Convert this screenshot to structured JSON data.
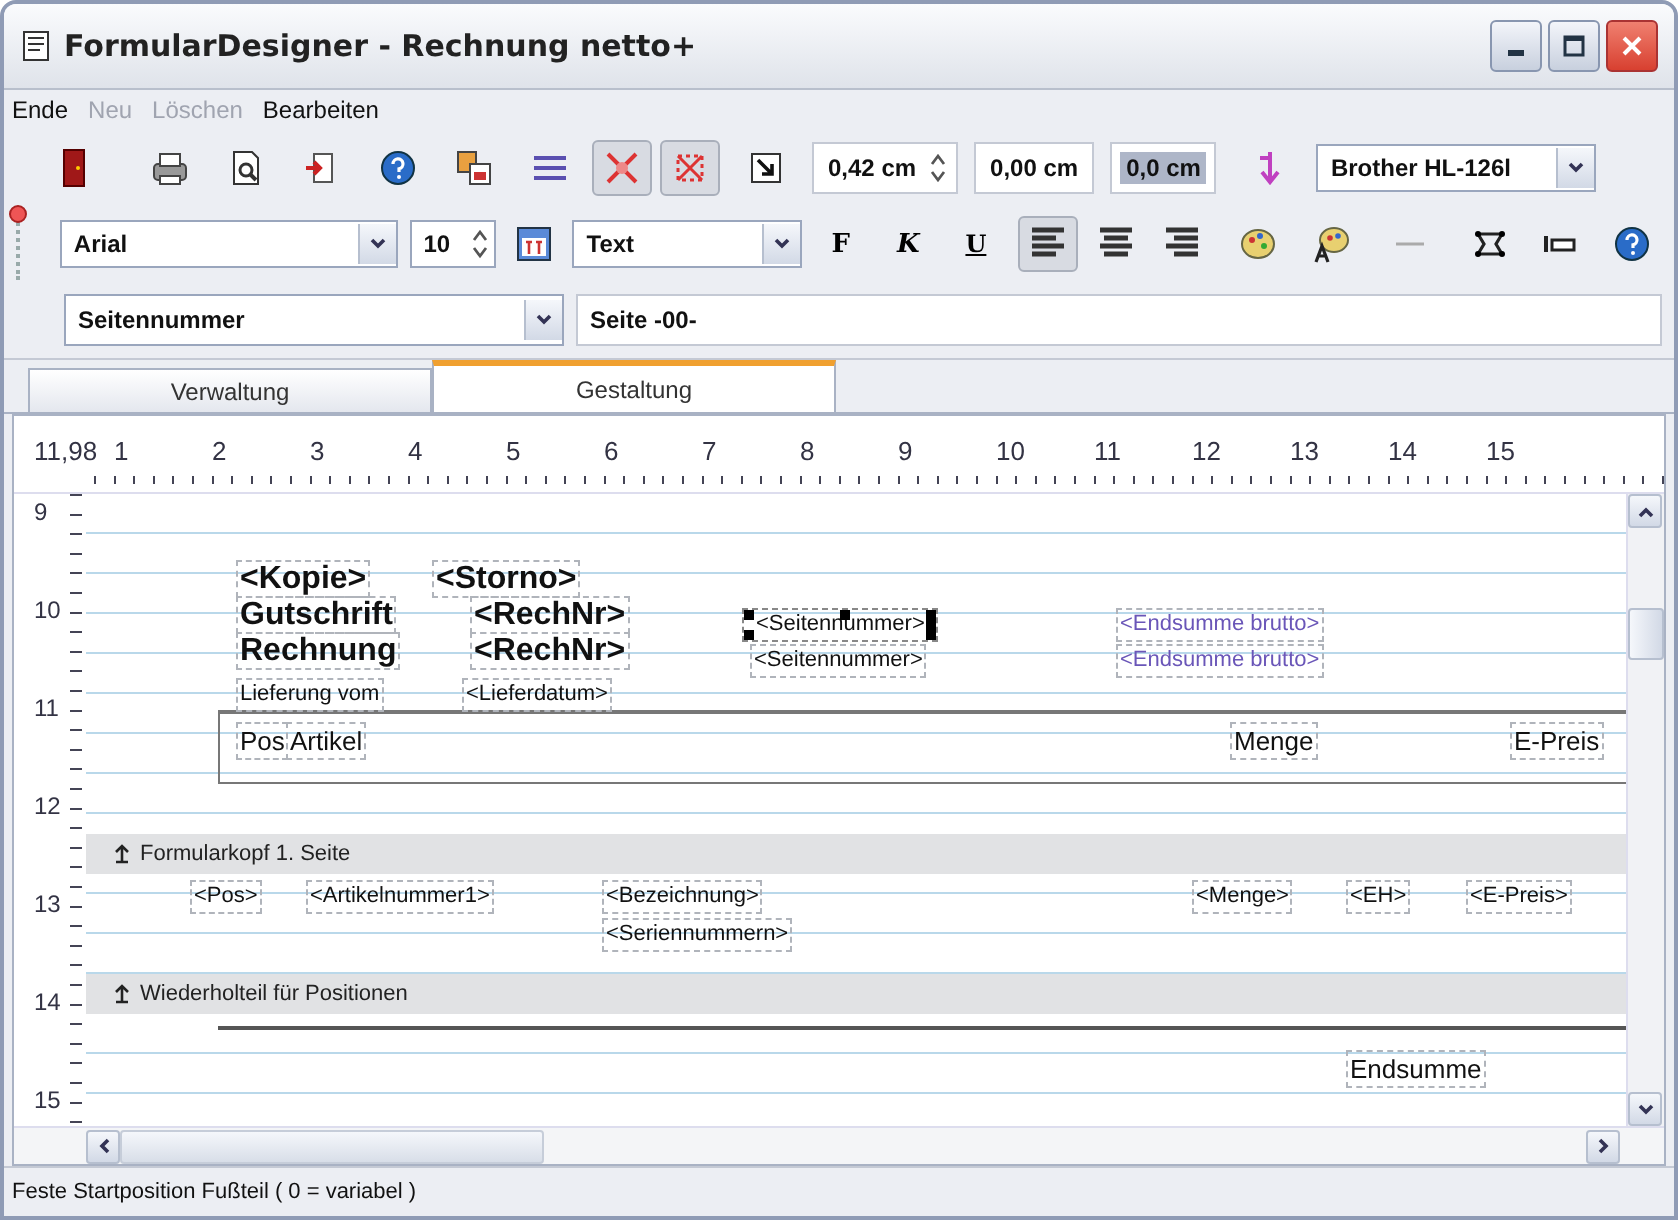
{
  "window": {
    "title": "FormularDesigner - Rechnung netto+"
  },
  "menu": [
    {
      "label": "Ende",
      "disabled": false
    },
    {
      "label": "Neu",
      "disabled": true
    },
    {
      "label": "Löschen",
      "disabled": true
    },
    {
      "label": "Bearbeiten",
      "disabled": false
    }
  ],
  "toolbar": {
    "buttons": [
      {
        "pressed": false
      },
      {
        "pressed": false
      },
      {
        "pressed": false
      },
      {
        "pressed": false
      },
      {
        "pressed": false
      },
      {
        "pressed": false
      },
      {
        "pressed": false
      },
      {
        "pressed": true
      },
      {
        "pressed": true
      },
      {
        "pressed": false
      }
    ],
    "measure_fields": [
      {
        "value": "0,42 cm",
        "kind": "spin",
        "selected": false
      },
      {
        "value": "0,00 cm",
        "kind": "plain",
        "selected": false
      },
      {
        "value": "0,0 cm",
        "kind": "plain",
        "selected": true
      }
    ],
    "printer": {
      "value": "Brother HL-126l"
    }
  },
  "format_bar": {
    "font": "Arial",
    "size": "10",
    "style": "Text",
    "text_buttons": [
      {
        "label": "F",
        "pressed": false
      },
      {
        "label": "K",
        "pressed": false
      },
      {
        "label": "U",
        "pressed": false
      }
    ],
    "buttons": [
      {
        "pressed": true
      },
      {
        "pressed": false
      },
      {
        "pressed": false
      },
      {
        "pressed": false
      },
      {
        "pressed": false
      },
      {
        "pressed": false
      },
      {
        "pressed": false
      },
      {
        "pressed": false
      },
      {
        "pressed": false
      }
    ]
  },
  "field_row": {
    "field": "Seitennummer",
    "content": "Seite -00-"
  },
  "tabs": [
    {
      "label": "Verwaltung",
      "selected": false
    },
    {
      "label": "Gestaltung",
      "selected": true
    }
  ],
  "ruler": {
    "horizontal": [
      "11,98",
      "1",
      "2",
      "3",
      "4",
      "5",
      "6",
      "7",
      "8",
      "9",
      "10",
      "11",
      "12",
      "13",
      "14",
      "15"
    ],
    "vertical": [
      "9",
      "10",
      "11",
      "12",
      "13",
      "14",
      "15"
    ]
  },
  "bands": [
    {
      "label": "Formularkopf 1. Seite"
    },
    {
      "label": "Wiederholteil für Positionen"
    }
  ],
  "fields": [
    {
      "text": "<Kopie>",
      "kind": "heading",
      "color": "#111111",
      "selected": false
    },
    {
      "text": "<Storno>",
      "kind": "heading",
      "color": "#111111",
      "selected": false
    },
    {
      "text": "Gutschrift",
      "kind": "heading",
      "color": "#111111",
      "selected": false
    },
    {
      "text": "<RechNr>",
      "kind": "heading",
      "color": "#111111",
      "selected": false
    },
    {
      "text": "<Seitennummer>",
      "kind": "text",
      "color": "#111111",
      "selected": true
    },
    {
      "text": "<Endsumme brutto>",
      "kind": "text",
      "color": "#6a56b8",
      "selected": false
    },
    {
      "text": "Rechnung",
      "kind": "heading",
      "color": "#111111",
      "selected": false
    },
    {
      "text": "<RechNr>",
      "kind": "heading",
      "color": "#111111",
      "selected": false
    },
    {
      "text": "<Seitennummer>",
      "kind": "text",
      "color": "#111111",
      "selected": false
    },
    {
      "text": "<Endsumme brutto>",
      "kind": "text",
      "color": "#6a56b8",
      "selected": false
    },
    {
      "text": "Lieferung vom",
      "kind": "text",
      "color": "#111111",
      "selected": false
    },
    {
      "text": "<Lieferdatum>",
      "kind": "text",
      "color": "#111111",
      "selected": false
    },
    {
      "text": "Pos",
      "kind": "label",
      "color": "#111111",
      "selected": false
    },
    {
      "text": "Artikel",
      "kind": "label",
      "color": "#111111",
      "selected": false
    },
    {
      "text": "Menge",
      "kind": "label",
      "color": "#111111",
      "selected": false
    },
    {
      "text": "E-Preis",
      "kind": "label",
      "color": "#111111",
      "selected": false
    },
    {
      "text": "<Pos>",
      "kind": "text",
      "color": "#111111",
      "selected": false
    },
    {
      "text": "<Artikelnummer1>",
      "kind": "text",
      "color": "#111111",
      "selected": false
    },
    {
      "text": "<Bezeichnung>",
      "kind": "text",
      "color": "#111111",
      "selected": false
    },
    {
      "text": "<Menge>",
      "kind": "text",
      "color": "#111111",
      "selected": false
    },
    {
      "text": "<EH>",
      "kind": "text",
      "color": "#111111",
      "selected": false
    },
    {
      "text": "<E-Preis>",
      "kind": "text",
      "color": "#111111",
      "selected": false
    },
    {
      "text": "<Seriennummern>",
      "kind": "text",
      "color": "#111111",
      "selected": false
    },
    {
      "text": "Endsumme",
      "kind": "label",
      "color": "#111111",
      "selected": false
    }
  ],
  "status_bar": "Feste Startposition Fußteil ( 0 = variabel )"
}
